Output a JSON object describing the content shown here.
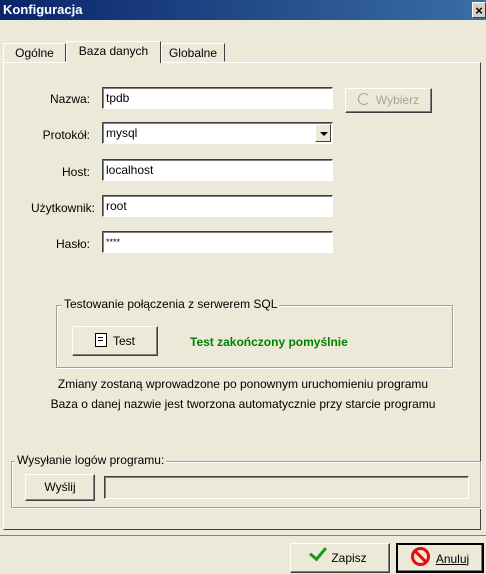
{
  "window": {
    "title": "Konfiguracja",
    "close_glyph": "×"
  },
  "tabs": [
    {
      "label": "Ogólne",
      "active": false
    },
    {
      "label": "Baza danych",
      "active": true
    },
    {
      "label": "Globalne",
      "active": false
    }
  ],
  "form": {
    "name_label": "Nazwa:",
    "name_value": "tpdb",
    "protocol_label": "Protokół:",
    "protocol_value": "mysql",
    "host_label": "Host:",
    "host_value": "localhost",
    "user_label": "Użytkownik:",
    "user_value": "root",
    "password_label": "Hasło:",
    "password_value": "****",
    "choose_button": "Wybierz"
  },
  "connection_test": {
    "group_title": "Testowanie połączenia z serwerem SQL",
    "test_button": "Test",
    "result_text": "Test zakończony pomyślnie",
    "result_color": "#008000"
  },
  "info": {
    "line1": "Zmiany zostaną wprowadzone po ponownym uruchomieniu programu",
    "line2": "Baza o danej nazwie jest tworzona automatycznie przy starcie programu"
  },
  "logs": {
    "group_title": "Wysyłanie logów programu:",
    "send_button": "Wyślij",
    "progress": 0
  },
  "footer": {
    "save_button": "Zapisz",
    "cancel_button": "Anuluj"
  }
}
